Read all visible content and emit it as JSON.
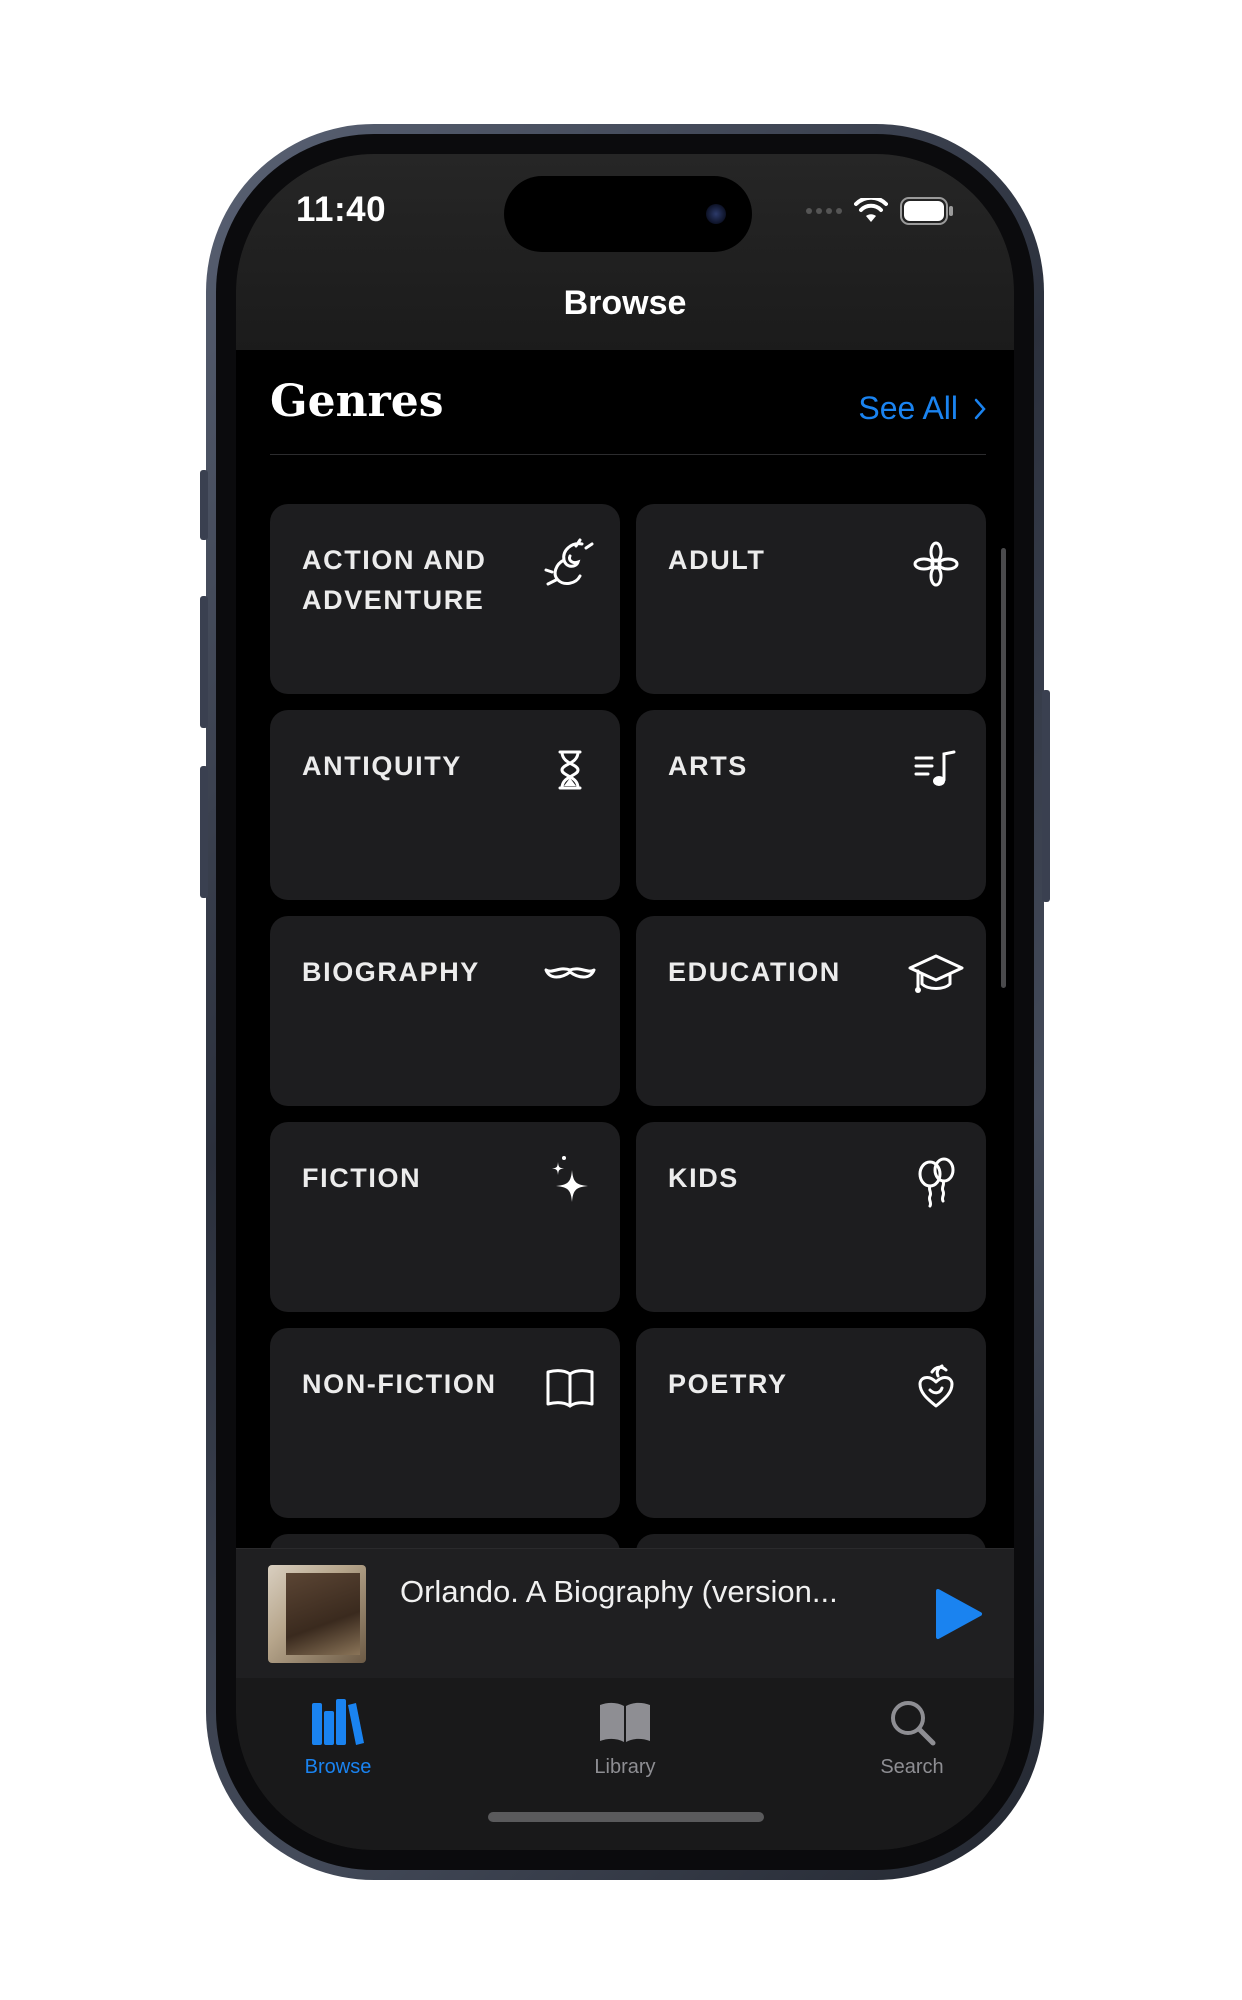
{
  "status_bar": {
    "time": "11:40",
    "icons": [
      "signal-icon",
      "wifi-icon",
      "battery-icon"
    ]
  },
  "nav": {
    "title": "Browse"
  },
  "section": {
    "title": "Genres",
    "see_all": "See All"
  },
  "genres": [
    {
      "label": "ACTION AND ADVENTURE",
      "icon": "dragon-icon"
    },
    {
      "label": "ADULT",
      "icon": "flower-icon"
    },
    {
      "label": "ANTIQUITY",
      "icon": "hourglass-icon"
    },
    {
      "label": "ARTS",
      "icon": "music-note-icon"
    },
    {
      "label": "BIOGRAPHY",
      "icon": "mustache-icon"
    },
    {
      "label": "EDUCATION",
      "icon": "graduation-cap-icon"
    },
    {
      "label": "FICTION",
      "icon": "sparkles-icon"
    },
    {
      "label": "KIDS",
      "icon": "balloons-icon"
    },
    {
      "label": "NON-FICTION",
      "icon": "open-book-icon"
    },
    {
      "label": "POETRY",
      "icon": "heart-flourish-icon"
    }
  ],
  "mini_player": {
    "title": "Orlando. A Biography (version..."
  },
  "tabs": [
    {
      "label": "Browse",
      "icon": "books-icon",
      "active": true
    },
    {
      "label": "Library",
      "icon": "library-book-icon",
      "active": false
    },
    {
      "label": "Search",
      "icon": "search-icon",
      "active": false
    }
  ],
  "colors": {
    "accent": "#1a83f0",
    "tile": "#1d1d1f",
    "background": "#000000"
  }
}
